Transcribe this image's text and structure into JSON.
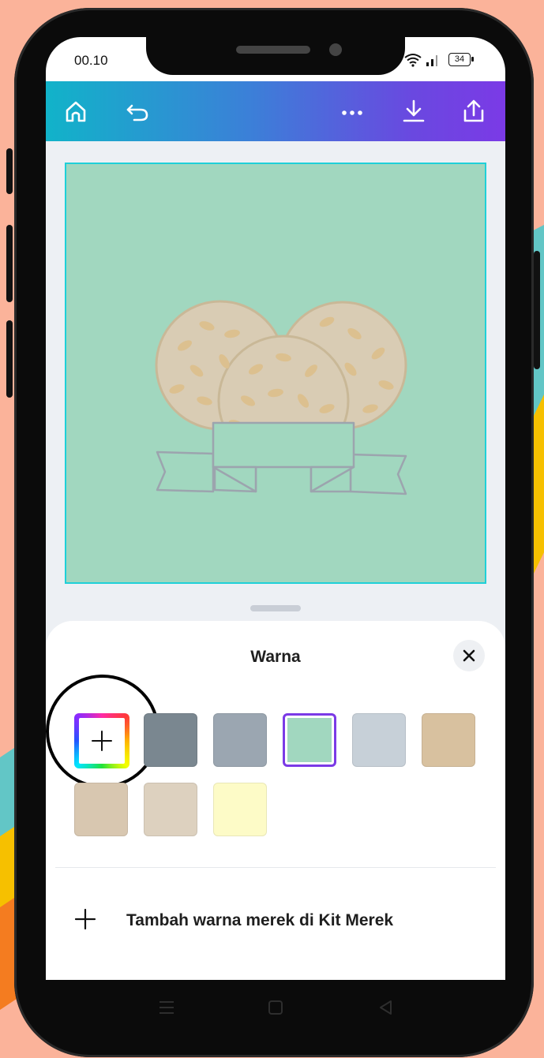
{
  "status_bar": {
    "time": "00.10",
    "battery": "34"
  },
  "toolbar": {
    "home_icon": "home-icon",
    "undo_icon": "undo-icon",
    "more_icon": "more-icon",
    "download_icon": "download-icon",
    "share_icon": "share-icon"
  },
  "design": {
    "background_color": "#a1d7bf"
  },
  "color_panel": {
    "title": "Warna",
    "close_icon": "close-icon",
    "picker_icon": "plus-icon",
    "swatches": [
      {
        "color": "#7a8790",
        "selected": false
      },
      {
        "color": "#9ba6b1",
        "selected": false
      },
      {
        "color": "#a1d7bf",
        "selected": true
      },
      {
        "color": "#c7d0d8",
        "selected": false
      },
      {
        "color": "#d8c19f",
        "selected": false
      },
      {
        "color": "#d8c7b0",
        "selected": false
      },
      {
        "color": "#ddd1bf",
        "selected": false
      },
      {
        "color": "#fdfbc7",
        "selected": false
      }
    ],
    "add_brand_label": "Tambah warna merek di Kit Merek"
  },
  "accent_color": "#7b3ae6"
}
